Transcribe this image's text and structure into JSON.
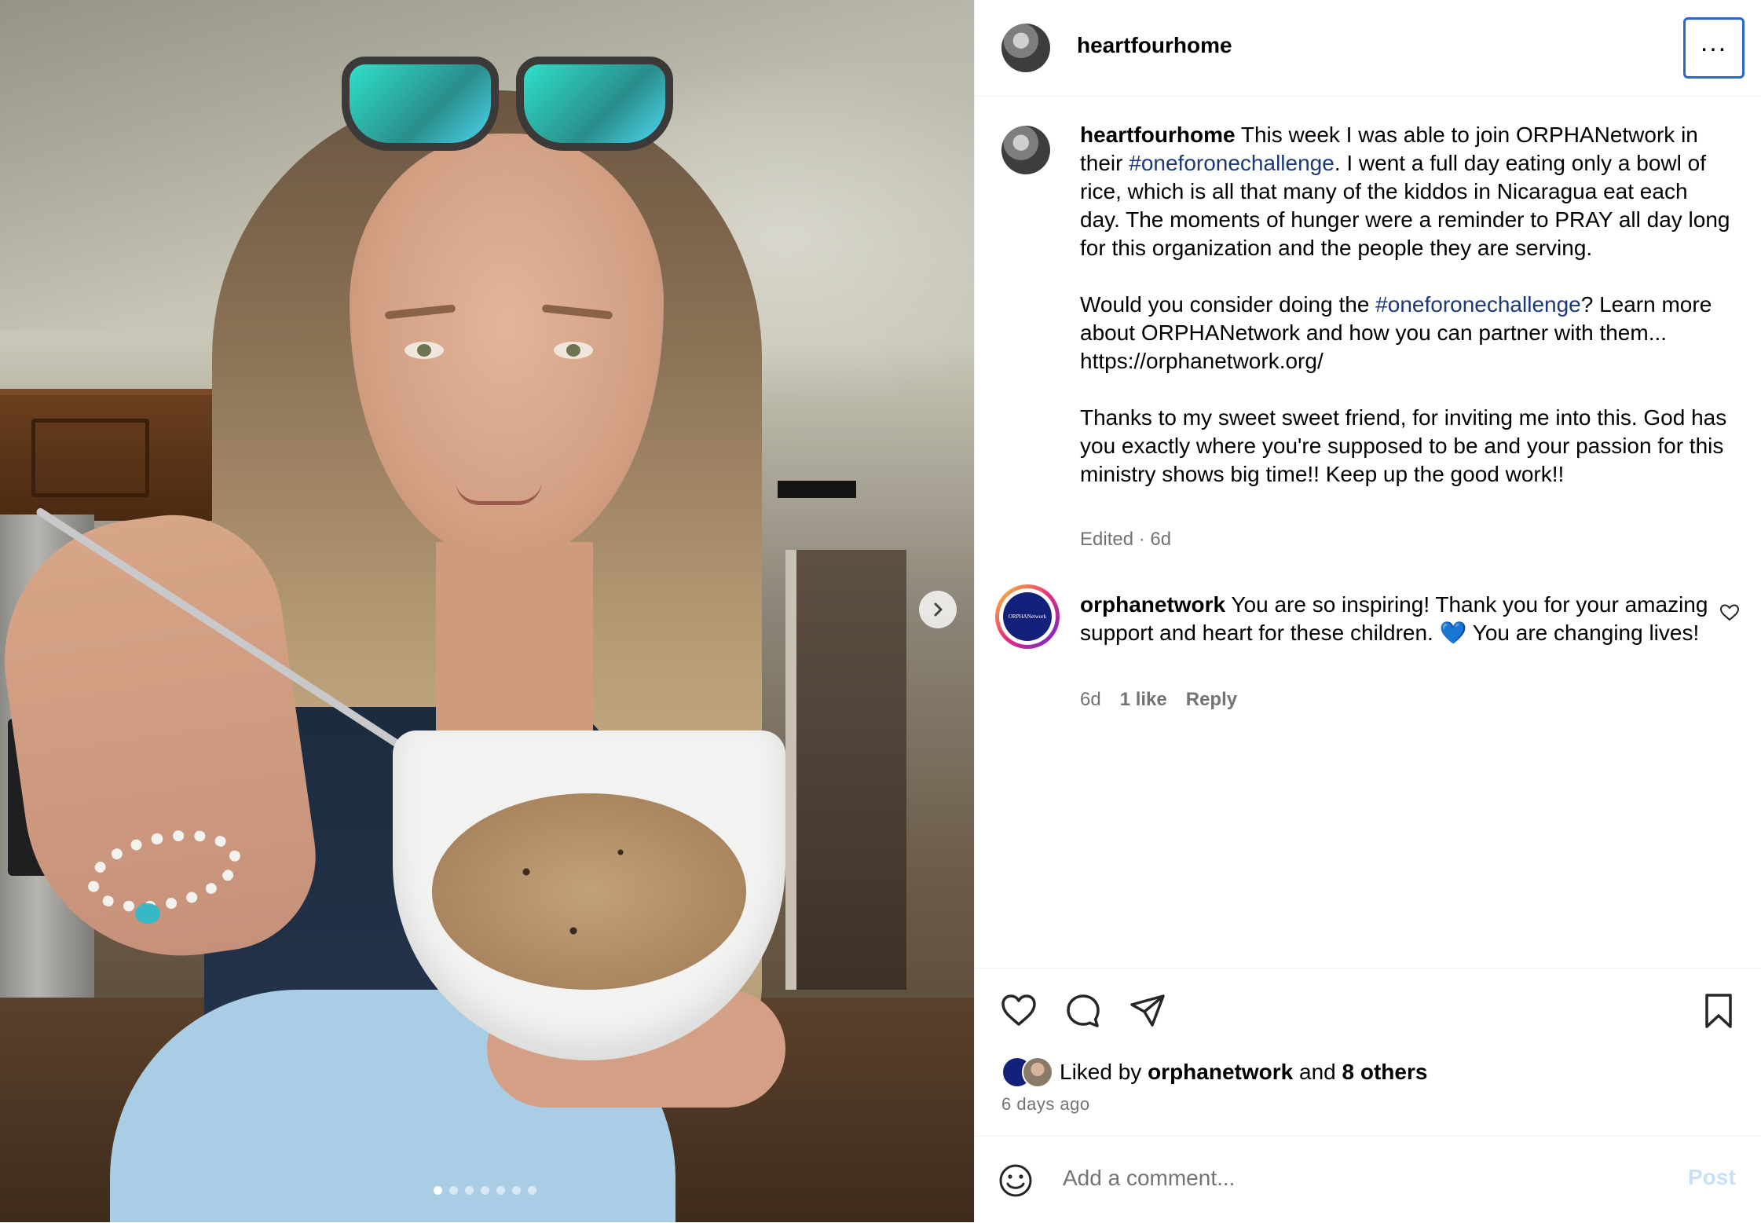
{
  "post": {
    "username": "heartfourhome",
    "caption_para1_text": "This week I was able to join ORPHANetwork in their ",
    "caption_hashtag": "#oneforonechallenge",
    "caption_para1_rest": ". I went a full day eating only a bowl of rice, which is all that many of the kiddos in Nicaragua eat each day. The moments of hunger were a reminder to PRAY all day long for this organization and the people they are serving.",
    "caption_para2_start": "Would you consider doing the ",
    "caption_para2_rest": "? Learn more about ORPHANetwork and how you can partner with them... https://orphanetwork.org/",
    "caption_para3": "Thanks to my sweet sweet friend, for inviting me into this. God has you exactly where you're supposed to be and your passion for this ministry shows big time!! Keep up the good work!!",
    "edited_label": "Edited · 6d",
    "media_slide": 1,
    "media_slide_count": 7
  },
  "comment": {
    "username": "orphanetwork",
    "avatar_text": "ORPHANetwork",
    "text": "You are so inspiring! Thank you for your amazing support and heart for these children. 💙 You are changing lives!",
    "age": "6d",
    "likes": "1 like",
    "reply_label": "Reply"
  },
  "likes": {
    "prefix": "Liked by",
    "liker": "orphanetwork",
    "and": "and",
    "others": "8 others",
    "time_ago": "6 days ago"
  },
  "add_comment": {
    "placeholder": "Add a comment...",
    "post_label": "Post"
  },
  "icons": [
    "more-icon",
    "chevron-right-icon",
    "heart-icon",
    "comment-icon",
    "share-icon",
    "bookmark-icon",
    "emoji-icon",
    "small-heart-icon"
  ],
  "colors": {
    "hashtag": "#1a3776",
    "focus_border": "#2b64d3",
    "post_disabled": "#c7dffa",
    "muted": "#737373"
  }
}
